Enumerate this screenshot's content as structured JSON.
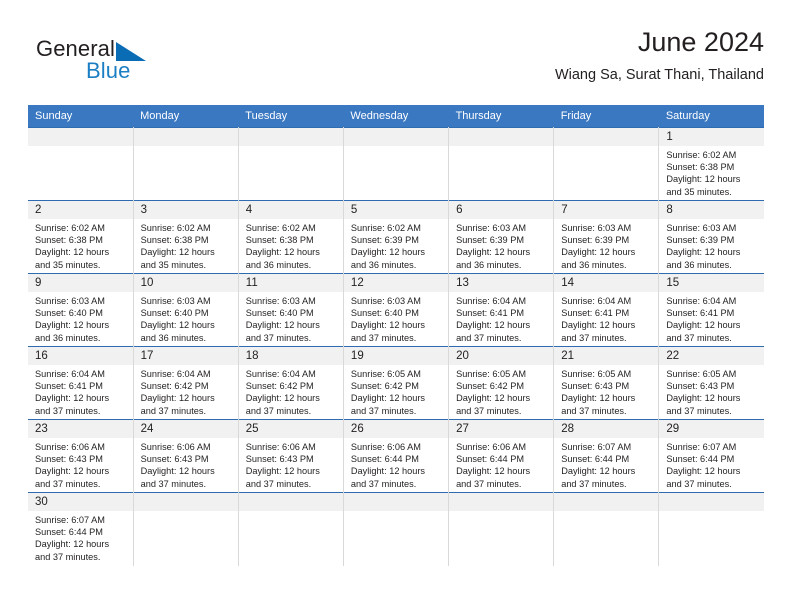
{
  "logo": {
    "word_one": "General",
    "word_two": "Blue",
    "flag_icon": "blue-triangle-flag-icon",
    "accent_color": "#1c7fc4",
    "text_color": "#231f20"
  },
  "header": {
    "title": "June 2024",
    "subtitle": "Wiang Sa, Surat Thani, Thailand"
  },
  "theme": {
    "header_bar_color": "#3a78c2",
    "row_divider_color": "#2e6bb0",
    "daynum_band_color": "#f1f1f1",
    "cell_divider_color": "#d9d9d9"
  },
  "weekday_headers": [
    "Sunday",
    "Monday",
    "Tuesday",
    "Wednesday",
    "Thursday",
    "Friday",
    "Saturday"
  ],
  "weeks": [
    [
      {
        "day": "",
        "lines": []
      },
      {
        "day": "",
        "lines": []
      },
      {
        "day": "",
        "lines": []
      },
      {
        "day": "",
        "lines": []
      },
      {
        "day": "",
        "lines": []
      },
      {
        "day": "",
        "lines": []
      },
      {
        "day": "1",
        "lines": [
          "Sunrise: 6:02 AM",
          "Sunset: 6:38 PM",
          "Daylight: 12 hours",
          "and 35 minutes."
        ]
      }
    ],
    [
      {
        "day": "2",
        "lines": [
          "Sunrise: 6:02 AM",
          "Sunset: 6:38 PM",
          "Daylight: 12 hours",
          "and 35 minutes."
        ]
      },
      {
        "day": "3",
        "lines": [
          "Sunrise: 6:02 AM",
          "Sunset: 6:38 PM",
          "Daylight: 12 hours",
          "and 35 minutes."
        ]
      },
      {
        "day": "4",
        "lines": [
          "Sunrise: 6:02 AM",
          "Sunset: 6:38 PM",
          "Daylight: 12 hours",
          "and 36 minutes."
        ]
      },
      {
        "day": "5",
        "lines": [
          "Sunrise: 6:02 AM",
          "Sunset: 6:39 PM",
          "Daylight: 12 hours",
          "and 36 minutes."
        ]
      },
      {
        "day": "6",
        "lines": [
          "Sunrise: 6:03 AM",
          "Sunset: 6:39 PM",
          "Daylight: 12 hours",
          "and 36 minutes."
        ]
      },
      {
        "day": "7",
        "lines": [
          "Sunrise: 6:03 AM",
          "Sunset: 6:39 PM",
          "Daylight: 12 hours",
          "and 36 minutes."
        ]
      },
      {
        "day": "8",
        "lines": [
          "Sunrise: 6:03 AM",
          "Sunset: 6:39 PM",
          "Daylight: 12 hours",
          "and 36 minutes."
        ]
      }
    ],
    [
      {
        "day": "9",
        "lines": [
          "Sunrise: 6:03 AM",
          "Sunset: 6:40 PM",
          "Daylight: 12 hours",
          "and 36 minutes."
        ]
      },
      {
        "day": "10",
        "lines": [
          "Sunrise: 6:03 AM",
          "Sunset: 6:40 PM",
          "Daylight: 12 hours",
          "and 36 minutes."
        ]
      },
      {
        "day": "11",
        "lines": [
          "Sunrise: 6:03 AM",
          "Sunset: 6:40 PM",
          "Daylight: 12 hours",
          "and 37 minutes."
        ]
      },
      {
        "day": "12",
        "lines": [
          "Sunrise: 6:03 AM",
          "Sunset: 6:40 PM",
          "Daylight: 12 hours",
          "and 37 minutes."
        ]
      },
      {
        "day": "13",
        "lines": [
          "Sunrise: 6:04 AM",
          "Sunset: 6:41 PM",
          "Daylight: 12 hours",
          "and 37 minutes."
        ]
      },
      {
        "day": "14",
        "lines": [
          "Sunrise: 6:04 AM",
          "Sunset: 6:41 PM",
          "Daylight: 12 hours",
          "and 37 minutes."
        ]
      },
      {
        "day": "15",
        "lines": [
          "Sunrise: 6:04 AM",
          "Sunset: 6:41 PM",
          "Daylight: 12 hours",
          "and 37 minutes."
        ]
      }
    ],
    [
      {
        "day": "16",
        "lines": [
          "Sunrise: 6:04 AM",
          "Sunset: 6:41 PM",
          "Daylight: 12 hours",
          "and 37 minutes."
        ]
      },
      {
        "day": "17",
        "lines": [
          "Sunrise: 6:04 AM",
          "Sunset: 6:42 PM",
          "Daylight: 12 hours",
          "and 37 minutes."
        ]
      },
      {
        "day": "18",
        "lines": [
          "Sunrise: 6:04 AM",
          "Sunset: 6:42 PM",
          "Daylight: 12 hours",
          "and 37 minutes."
        ]
      },
      {
        "day": "19",
        "lines": [
          "Sunrise: 6:05 AM",
          "Sunset: 6:42 PM",
          "Daylight: 12 hours",
          "and 37 minutes."
        ]
      },
      {
        "day": "20",
        "lines": [
          "Sunrise: 6:05 AM",
          "Sunset: 6:42 PM",
          "Daylight: 12 hours",
          "and 37 minutes."
        ]
      },
      {
        "day": "21",
        "lines": [
          "Sunrise: 6:05 AM",
          "Sunset: 6:43 PM",
          "Daylight: 12 hours",
          "and 37 minutes."
        ]
      },
      {
        "day": "22",
        "lines": [
          "Sunrise: 6:05 AM",
          "Sunset: 6:43 PM",
          "Daylight: 12 hours",
          "and 37 minutes."
        ]
      }
    ],
    [
      {
        "day": "23",
        "lines": [
          "Sunrise: 6:06 AM",
          "Sunset: 6:43 PM",
          "Daylight: 12 hours",
          "and 37 minutes."
        ]
      },
      {
        "day": "24",
        "lines": [
          "Sunrise: 6:06 AM",
          "Sunset: 6:43 PM",
          "Daylight: 12 hours",
          "and 37 minutes."
        ]
      },
      {
        "day": "25",
        "lines": [
          "Sunrise: 6:06 AM",
          "Sunset: 6:43 PM",
          "Daylight: 12 hours",
          "and 37 minutes."
        ]
      },
      {
        "day": "26",
        "lines": [
          "Sunrise: 6:06 AM",
          "Sunset: 6:44 PM",
          "Daylight: 12 hours",
          "and 37 minutes."
        ]
      },
      {
        "day": "27",
        "lines": [
          "Sunrise: 6:06 AM",
          "Sunset: 6:44 PM",
          "Daylight: 12 hours",
          "and 37 minutes."
        ]
      },
      {
        "day": "28",
        "lines": [
          "Sunrise: 6:07 AM",
          "Sunset: 6:44 PM",
          "Daylight: 12 hours",
          "and 37 minutes."
        ]
      },
      {
        "day": "29",
        "lines": [
          "Sunrise: 6:07 AM",
          "Sunset: 6:44 PM",
          "Daylight: 12 hours",
          "and 37 minutes."
        ]
      }
    ],
    [
      {
        "day": "30",
        "lines": [
          "Sunrise: 6:07 AM",
          "Sunset: 6:44 PM",
          "Daylight: 12 hours",
          "and 37 minutes."
        ]
      },
      {
        "day": "",
        "lines": []
      },
      {
        "day": "",
        "lines": []
      },
      {
        "day": "",
        "lines": []
      },
      {
        "day": "",
        "lines": []
      },
      {
        "day": "",
        "lines": []
      },
      {
        "day": "",
        "lines": []
      }
    ]
  ]
}
